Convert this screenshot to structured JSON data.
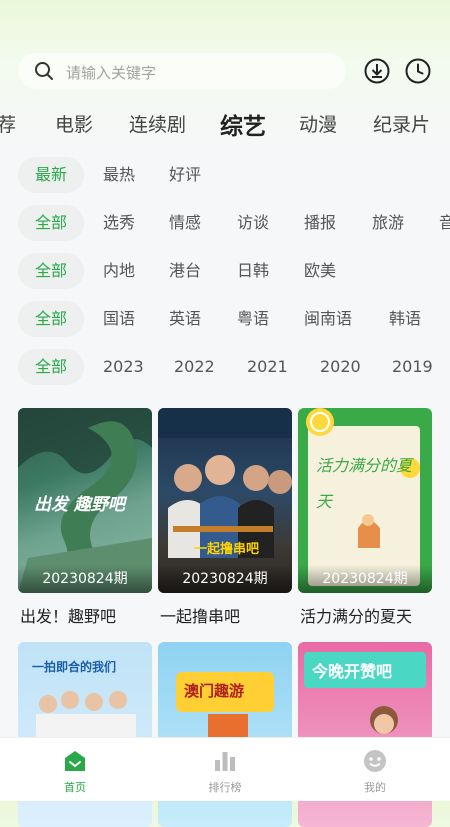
{
  "search": {
    "placeholder": "请输入关键字"
  },
  "header_icons": [
    "download-icon",
    "history-clock-icon"
  ],
  "category_tabs": [
    {
      "label": "荐"
    },
    {
      "label": "电影"
    },
    {
      "label": "连续剧"
    },
    {
      "label": "综艺",
      "active": true
    },
    {
      "label": "动漫"
    },
    {
      "label": "纪录片"
    }
  ],
  "filters": {
    "sort": [
      "最新",
      "最热",
      "好评"
    ],
    "type": [
      "全部",
      "选秀",
      "情感",
      "访谈",
      "播报",
      "旅游",
      "音"
    ],
    "region": [
      "全部",
      "内地",
      "港台",
      "日韩",
      "欧美"
    ],
    "language": [
      "全部",
      "国语",
      "英语",
      "粤语",
      "闽南语",
      "韩语"
    ],
    "year": [
      "全部",
      "2023",
      "2022",
      "2021",
      "2020",
      "2019"
    ]
  },
  "cards": [
    {
      "title": "出发！趣野吧",
      "episode": "20230824期",
      "poster_text": "出发 趣野吧"
    },
    {
      "title": "一起撸串吧",
      "episode": "20230824期",
      "poster_text": "一起撸串吧"
    },
    {
      "title": "活力满分的夏天",
      "episode": "20230824期",
      "poster_text": "活力满分的夏天"
    },
    {
      "title": "",
      "episode": "",
      "poster_text": "一拍即合的我们"
    },
    {
      "title": "",
      "episode": "",
      "poster_text": "澳门趣游"
    },
    {
      "title": "",
      "episode": "",
      "poster_text": "今晚开赞吧"
    }
  ],
  "bottom_nav": [
    {
      "label": "首页",
      "icon": "home-icon",
      "active": true
    },
    {
      "label": "排行榜",
      "icon": "chart-icon"
    },
    {
      "label": "我的",
      "icon": "profile-icon"
    }
  ],
  "colors": {
    "accent": "#2aa84a",
    "background": "#f6f7f9"
  }
}
